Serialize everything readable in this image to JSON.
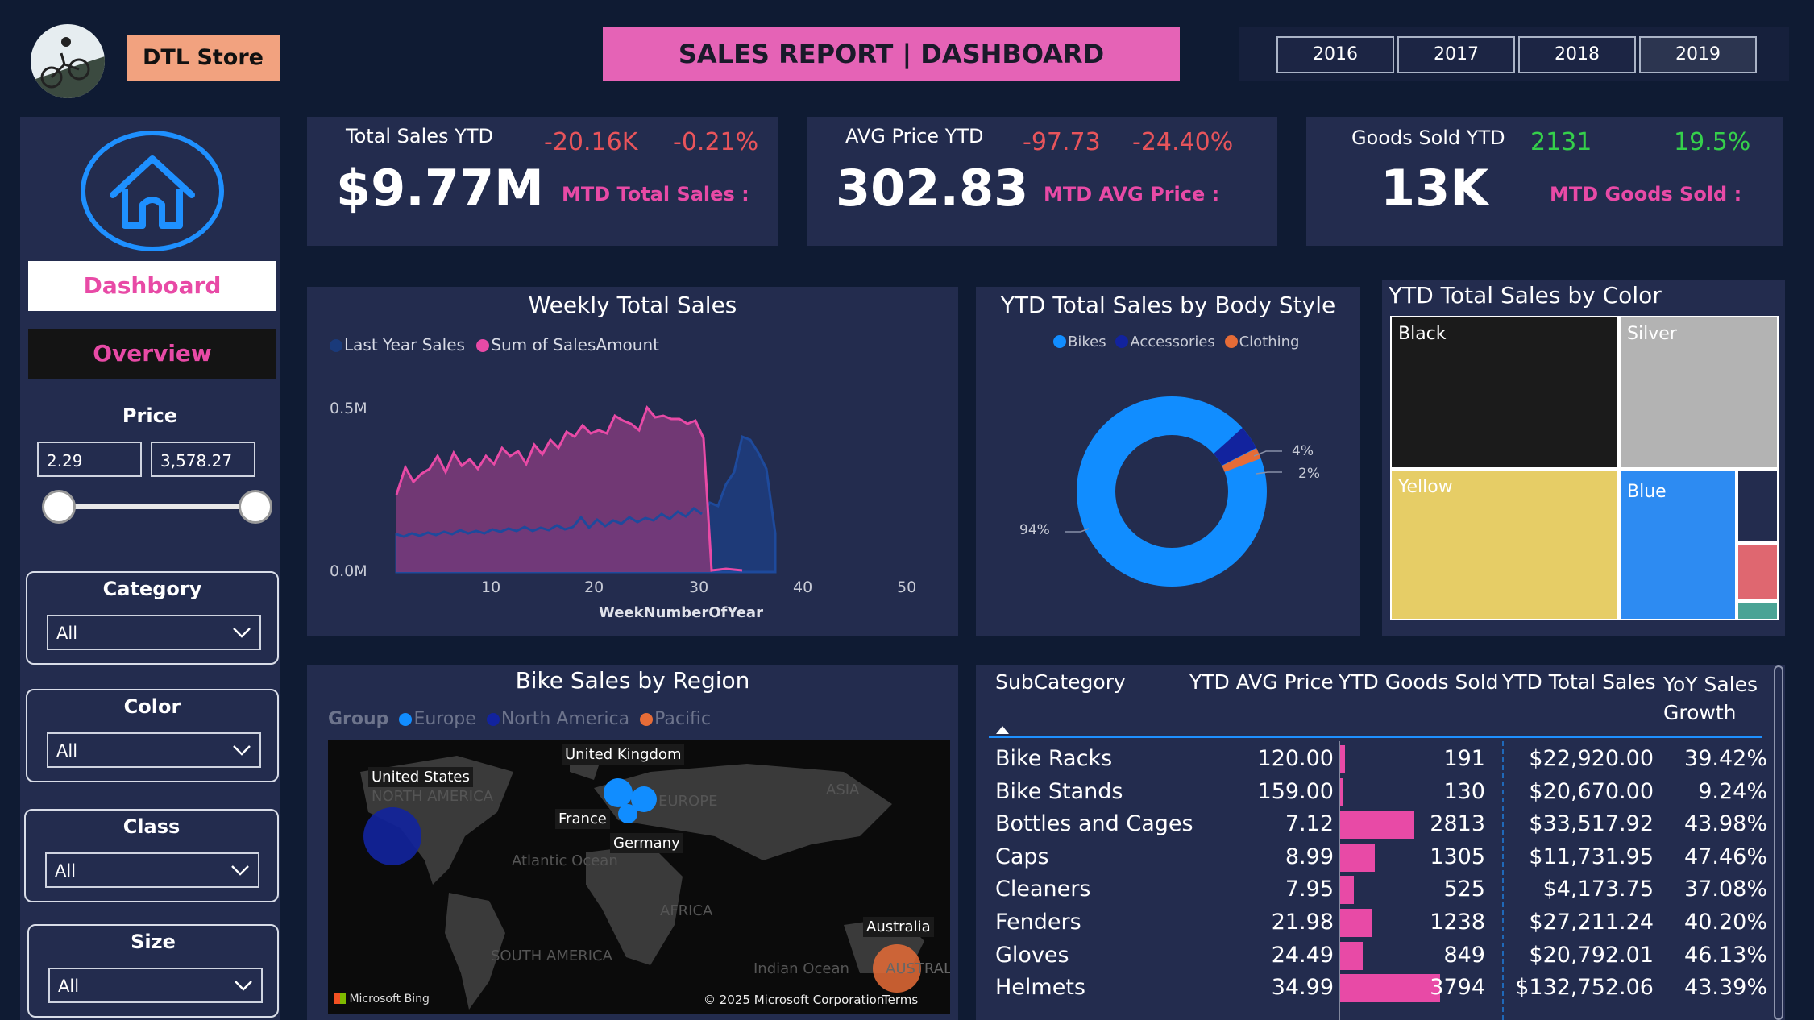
{
  "header": {
    "store_label": "DTL Store",
    "title": "SALES REPORT | DASHBOARD",
    "years": [
      "2016",
      "2017",
      "2018",
      "2019"
    ]
  },
  "sidebar": {
    "nav_dashboard": "Dashboard",
    "nav_overview": "Overview",
    "price": {
      "label": "Price",
      "min": "2.29",
      "max": "3,578.27"
    },
    "slicers": [
      {
        "label": "Category",
        "value": "All"
      },
      {
        "label": "Color",
        "value": "All"
      },
      {
        "label": "Class",
        "value": "All"
      },
      {
        "label": "Size",
        "value": "All"
      }
    ]
  },
  "kpis": [
    {
      "title": "Total Sales YTD",
      "value": "$9.77M",
      "delta": "-20.16K",
      "pct": "-0.21%",
      "mtd_label": "MTD Total Sales :",
      "positive": false
    },
    {
      "title": "AVG Price YTD",
      "value": "302.83",
      "delta": "-97.73",
      "pct": "-24.40%",
      "mtd_label": "MTD AVG Price :",
      "positive": false
    },
    {
      "title": "Goods Sold YTD",
      "value": "13K",
      "delta": "2131",
      "pct": "19.5%",
      "mtd_label": "MTD Goods Sold :",
      "positive": true
    }
  ],
  "weekly": {
    "title": "Weekly Total Sales",
    "legend": [
      "Last Year Sales",
      "Sum of SalesAmount"
    ],
    "xlabel": "WeekNumberOfYear",
    "yticks": [
      "0.5M",
      "0.0M"
    ],
    "xticks": [
      "10",
      "20",
      "30",
      "40",
      "50"
    ],
    "colors": {
      "last_year": "#1a3a7a",
      "current": "#e84aa6"
    }
  },
  "body_style": {
    "title": "YTD Total Sales by Body Style",
    "legend": [
      "Bikes",
      "Accessories",
      "Clothing"
    ],
    "labels": [
      "4%",
      "2%",
      "94%"
    ]
  },
  "color_chart": {
    "title": "YTD Total Sales by Color",
    "labels": [
      "Black",
      "Silver",
      "Yellow",
      "Blue"
    ]
  },
  "region": {
    "title": "Bike Sales by Region",
    "legend_title": "Group",
    "legend": [
      "Europe",
      "North America",
      "Pacific"
    ],
    "map_labels": {
      "us": "United States",
      "uk": "United Kingdom",
      "france": "France",
      "germany": "Germany",
      "australia": "Australia",
      "north_america": "NORTH AMERICA",
      "europe": "EUROPE",
      "asia": "ASIA",
      "africa": "AFRICA",
      "south_america": "SOUTH AMERICA",
      "atlantic": "Atlantic Ocean",
      "indian": "Indian Ocean",
      "austral": "AUSTRAL"
    },
    "attribution": "Microsoft Bing",
    "copyright": "© 2025 Microsoft Corporation",
    "terms": "Terms"
  },
  "table": {
    "headers": [
      "SubCategory",
      "YTD AVG Price",
      "YTD Goods Sold",
      "YTD Total Sales",
      "YoY Sales",
      "Growth"
    ],
    "rows": [
      {
        "name": "Bike Racks",
        "price": "120.00",
        "sold": "191",
        "sold_n": 191,
        "sales": "$22,920.00",
        "yoy": "39.42%"
      },
      {
        "name": "Bike Stands",
        "price": "159.00",
        "sold": "130",
        "sold_n": 130,
        "sales": "$20,670.00",
        "yoy": "9.24%"
      },
      {
        "name": "Bottles and Cages",
        "price": "7.12",
        "sold": "2813",
        "sold_n": 2813,
        "sales": "$33,517.92",
        "yoy": "43.98%"
      },
      {
        "name": "Caps",
        "price": "8.99",
        "sold": "1305",
        "sold_n": 1305,
        "sales": "$11,731.95",
        "yoy": "47.46%"
      },
      {
        "name": "Cleaners",
        "price": "7.95",
        "sold": "525",
        "sold_n": 525,
        "sales": "$4,173.75",
        "yoy": "37.08%"
      },
      {
        "name": "Fenders",
        "price": "21.98",
        "sold": "1238",
        "sold_n": 1238,
        "sales": "$27,211.24",
        "yoy": "40.20%"
      },
      {
        "name": "Gloves",
        "price": "24.49",
        "sold": "849",
        "sold_n": 849,
        "sales": "$20,792.01",
        "yoy": "46.13%"
      },
      {
        "name": "Helmets",
        "price": "34.99",
        "sold": "3794",
        "sold_n": 3794,
        "sales": "$132,752.06",
        "yoy": "43.39%"
      }
    ]
  }
}
